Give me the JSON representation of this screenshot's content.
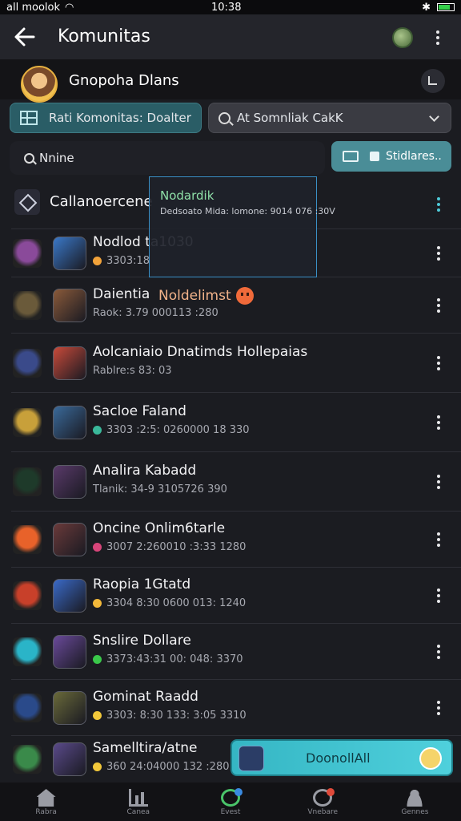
{
  "status_bar": {
    "carrier": "all moolok",
    "time": "10:38"
  },
  "app_bar": {
    "title": "Komunitas"
  },
  "group": {
    "name": "Gnopoha Dlans"
  },
  "filters": {
    "chip_a_label": "Rati Komonitas: Doalter",
    "chip_b_label": "At Somnliak CakK"
  },
  "search": {
    "value": "Nnine"
  },
  "stickers_button": {
    "label": "Stidlares.."
  },
  "category": {
    "title": "Callanoercene"
  },
  "tooltip": {
    "title": "Nodardik",
    "line": "Dedsoato Mida: lomone: 9014 076 :30V",
    "value": "Nodlod ta1030"
  },
  "notice": {
    "text": "Noldelimst"
  },
  "rows": [
    {
      "title": "Nodlod ta1030",
      "sub": "3303:18",
      "dot_color": "#f2a33a",
      "lead_color": "#8a4a9a",
      "game_color": "#3a78c8"
    },
    {
      "title": "Daientia",
      "sub": "Raok: 3.79  000113 :280",
      "dot_color": "",
      "lead_color": "#6a5a3a",
      "game_color": "#8a5a3a"
    },
    {
      "title": "Aolcaniaio Dnatimds Hollepaias",
      "sub": "Rablre:s 83: 03",
      "dot_color": "",
      "lead_color": "#3a4a8a",
      "game_color": "#c84a3a"
    },
    {
      "title": "Sacloe Faland",
      "sub": "3303 :2:5: 0260000 18 330",
      "dot_color": "#3ab89a",
      "lead_color": "#c8a03a",
      "game_color": "#3a6a9a"
    },
    {
      "title": "Analira Kabadd",
      "sub": "Tlanik: 34-9  3105726 390",
      "dot_color": "",
      "lead_color": "#1e3a2a",
      "game_color": "#5a3a6a"
    },
    {
      "title": "Oncine Onlim6tarle",
      "sub": "3007 2:260010 :3:33 1280",
      "dot_color": "#d8457a",
      "lead_color": "#e8622a",
      "game_color": "#6a3a3a"
    },
    {
      "title": "Raopia 1Gtatd",
      "sub": "3304 8:30 0600 013: 1240",
      "dot_color": "#f2b83a",
      "lead_color": "#c8402a",
      "game_color": "#3a6ac8"
    },
    {
      "title": "Snslire Dollare",
      "sub": "3373:43:31 00: 048: 3370",
      "dot_color": "#3ac84a",
      "lead_color": "#2ab4c8",
      "game_color": "#6a4a9a"
    },
    {
      "title": "Gominat Raadd",
      "sub": "3303: 8:30 133: 3:05 3310",
      "dot_color": "#f2c83a",
      "lead_color": "#2a4a8a",
      "game_color": "#6a6a3a"
    },
    {
      "title": "Samelltira/atne",
      "sub": "360 24:04000 132 :280",
      "dot_color": "#f2c83a",
      "lead_color": "#3a8a4a",
      "game_color": "#5a4a8a"
    }
  ],
  "banner": {
    "label": "DoonollAll"
  },
  "bottom_nav": [
    {
      "label": "Rabra",
      "icon": "home-icon"
    },
    {
      "label": "Canea",
      "icon": "chart-icon"
    },
    {
      "label": "Evest",
      "icon": "event-icon"
    },
    {
      "label": "Vnebare",
      "icon": "globe-icon"
    },
    {
      "label": "Gennes",
      "icon": "user-icon"
    }
  ],
  "colors": {
    "background": "#1b1c21",
    "accent": "#4ec9d8",
    "chip_active": "#2a5d66",
    "banner": "#35b6c4"
  }
}
